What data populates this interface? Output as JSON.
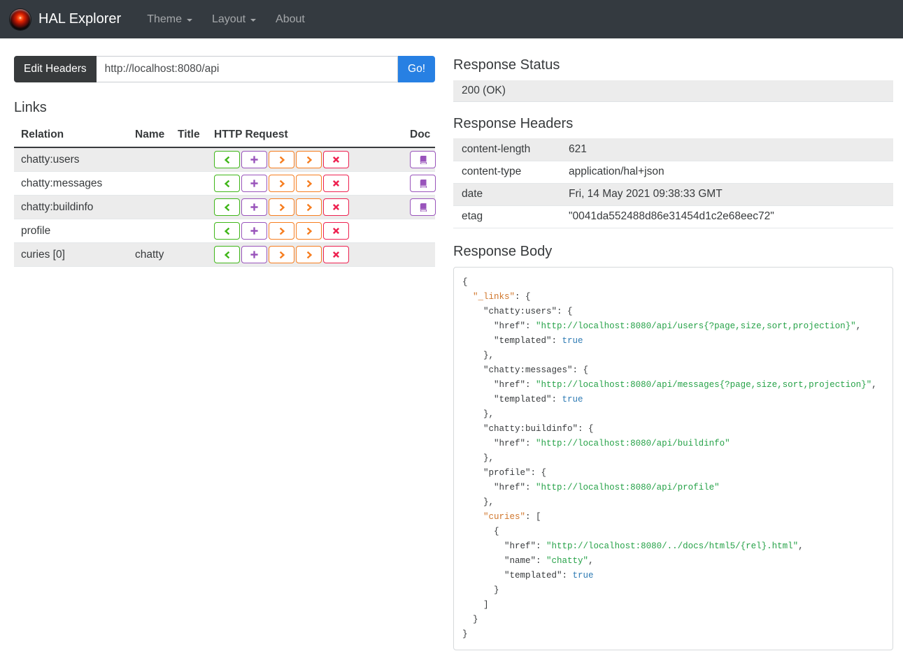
{
  "navbar": {
    "brand": "HAL Explorer",
    "menu": [
      {
        "label": "Theme",
        "caret": true
      },
      {
        "label": "Layout",
        "caret": true
      },
      {
        "label": "About",
        "caret": false
      }
    ]
  },
  "request_bar": {
    "edit_headers_label": "Edit Headers",
    "url_value": "http://localhost:8080/api",
    "go_label": "Go!"
  },
  "links_section": {
    "title": "Links",
    "columns": [
      "Relation",
      "Name",
      "Title",
      "HTTP Request",
      "Doc"
    ],
    "http_buttons": [
      {
        "name": "get-request",
        "glyph": "chevron-left",
        "color": "#3fb618"
      },
      {
        "name": "post-request",
        "glyph": "plus",
        "color": "#9954bb"
      },
      {
        "name": "put-request",
        "glyph": "chevron-right",
        "color": "#f67d1f"
      },
      {
        "name": "patch-request",
        "glyph": "chevron-right",
        "color": "#f67d1f"
      },
      {
        "name": "delete-request",
        "glyph": "x",
        "color": "#ee2150"
      }
    ],
    "doc_button": {
      "glyph": "book",
      "color": "#9954bb"
    },
    "rows": [
      {
        "relation": "chatty:users",
        "name": "",
        "title": "",
        "doc": true
      },
      {
        "relation": "chatty:messages",
        "name": "",
        "title": "",
        "doc": true
      },
      {
        "relation": "chatty:buildinfo",
        "name": "",
        "title": "",
        "doc": true
      },
      {
        "relation": "profile",
        "name": "",
        "title": "",
        "doc": false
      },
      {
        "relation": "curies [0]",
        "name": "chatty",
        "title": "",
        "doc": false
      }
    ]
  },
  "response_status": {
    "title": "Response Status",
    "value": "200 (OK)"
  },
  "response_headers": {
    "title": "Response Headers",
    "rows": [
      {
        "key": "content-length",
        "value": "621"
      },
      {
        "key": "content-type",
        "value": "application/hal+json"
      },
      {
        "key": "date",
        "value": "Fri, 14 May 2021 09:38:33 GMT"
      },
      {
        "key": "etag",
        "value": "\"0041da552488d86e31454d1c2e68eec72\""
      }
    ]
  },
  "response_body": {
    "title": "Response Body",
    "lines": [
      [
        [
          "p",
          "{"
        ]
      ],
      [
        [
          "p",
          "  "
        ],
        [
          "h",
          "\"_links\""
        ],
        [
          "p",
          ": {"
        ]
      ],
      [
        [
          "p",
          "    "
        ],
        [
          "k",
          "\"chatty:users\""
        ],
        [
          "p",
          ": {"
        ]
      ],
      [
        [
          "p",
          "      "
        ],
        [
          "k",
          "\"href\""
        ],
        [
          "p",
          ": "
        ],
        [
          "s",
          "\"http://localhost:8080/api/users{?page,size,sort,projection}\""
        ],
        [
          "p",
          ","
        ]
      ],
      [
        [
          "p",
          "      "
        ],
        [
          "k",
          "\"templated\""
        ],
        [
          "p",
          ": "
        ],
        [
          "b",
          "true"
        ]
      ],
      [
        [
          "p",
          "    },"
        ]
      ],
      [
        [
          "p",
          "    "
        ],
        [
          "k",
          "\"chatty:messages\""
        ],
        [
          "p",
          ": {"
        ]
      ],
      [
        [
          "p",
          "      "
        ],
        [
          "k",
          "\"href\""
        ],
        [
          "p",
          ": "
        ],
        [
          "s",
          "\"http://localhost:8080/api/messages{?page,size,sort,projection}\""
        ],
        [
          "p",
          ","
        ]
      ],
      [
        [
          "p",
          "      "
        ],
        [
          "k",
          "\"templated\""
        ],
        [
          "p",
          ": "
        ],
        [
          "b",
          "true"
        ]
      ],
      [
        [
          "p",
          "    },"
        ]
      ],
      [
        [
          "p",
          "    "
        ],
        [
          "k",
          "\"chatty:buildinfo\""
        ],
        [
          "p",
          ": {"
        ]
      ],
      [
        [
          "p",
          "      "
        ],
        [
          "k",
          "\"href\""
        ],
        [
          "p",
          ": "
        ],
        [
          "s",
          "\"http://localhost:8080/api/buildinfo\""
        ]
      ],
      [
        [
          "p",
          "    },"
        ]
      ],
      [
        [
          "p",
          "    "
        ],
        [
          "k",
          "\"profile\""
        ],
        [
          "p",
          ": {"
        ]
      ],
      [
        [
          "p",
          "      "
        ],
        [
          "k",
          "\"href\""
        ],
        [
          "p",
          ": "
        ],
        [
          "s",
          "\"http://localhost:8080/api/profile\""
        ]
      ],
      [
        [
          "p",
          "    },"
        ]
      ],
      [
        [
          "p",
          "    "
        ],
        [
          "h",
          "\"curies\""
        ],
        [
          "p",
          ": ["
        ]
      ],
      [
        [
          "p",
          "      {"
        ]
      ],
      [
        [
          "p",
          "        "
        ],
        [
          "k",
          "\"href\""
        ],
        [
          "p",
          ": "
        ],
        [
          "s",
          "\"http://localhost:8080/../docs/html5/{rel}.html\""
        ],
        [
          "p",
          ","
        ]
      ],
      [
        [
          "p",
          "        "
        ],
        [
          "k",
          "\"name\""
        ],
        [
          "p",
          ": "
        ],
        [
          "s",
          "\"chatty\""
        ],
        [
          "p",
          ","
        ]
      ],
      [
        [
          "p",
          "        "
        ],
        [
          "k",
          "\"templated\""
        ],
        [
          "p",
          ": "
        ],
        [
          "b",
          "true"
        ]
      ],
      [
        [
          "p",
          "      }"
        ]
      ],
      [
        [
          "p",
          "    ]"
        ]
      ],
      [
        [
          "p",
          "  }"
        ]
      ],
      [
        [
          "p",
          "}"
        ]
      ]
    ]
  },
  "colors": {
    "navbar_bg": "#343a40",
    "primary_blue": "#2780e3",
    "dark": "#373a3c",
    "row_stripe": "#ececec",
    "get_green": "#3fb618",
    "post_purple": "#9954bb",
    "put_patch_orange": "#f67d1f",
    "delete_red": "#ee2150",
    "doc_purple": "#9954bb",
    "code_hal_key_orange": "#d0762b",
    "code_string_green": "#26a248",
    "code_boolean_blue": "#2e7bb4"
  }
}
